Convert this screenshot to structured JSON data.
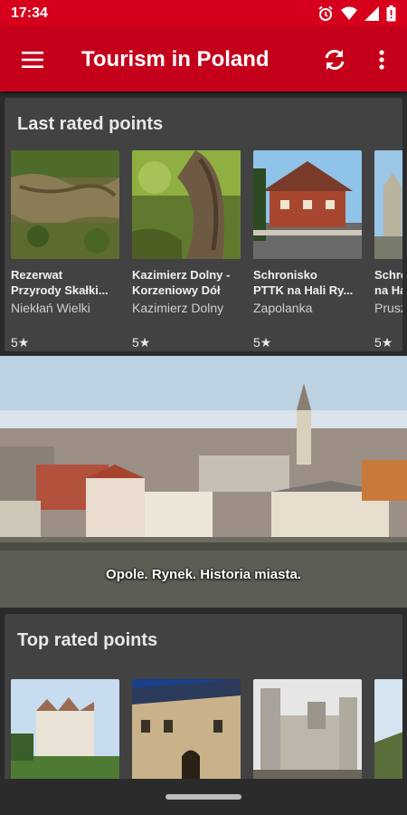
{
  "status_bar": {
    "time": "17:34",
    "icons": [
      "alarm-icon",
      "wifi-icon",
      "signal-icon",
      "battery-alert-icon"
    ]
  },
  "app_bar": {
    "title": "Tourism in Poland",
    "menu_icon": "hamburger-menu-icon",
    "refresh_icon": "refresh-icon",
    "more_icon": "more-vertical-icon",
    "accent_color": "#c4001a"
  },
  "last_rated": {
    "title": "Last rated points",
    "items": [
      {
        "name": "Rezerwat\nPrzyrody Skałki...",
        "place": "Niekłań Wielki",
        "rating": "5★"
      },
      {
        "name": "Kazimierz Dolny -\nKorzeniowy Dół",
        "place": "Kazimierz Dolny",
        "rating": "5★"
      },
      {
        "name": " Schronisko\nPTTK na Hali Ry...",
        "place": "Zapolanka",
        "rating": "5★"
      },
      {
        "name": "Schro\nna Ha",
        "place": "Prusz",
        "rating": "5★"
      }
    ]
  },
  "banner": {
    "caption": "Opole. Rynek. Historia miasta."
  },
  "top_rated": {
    "title": "Top rated points"
  }
}
